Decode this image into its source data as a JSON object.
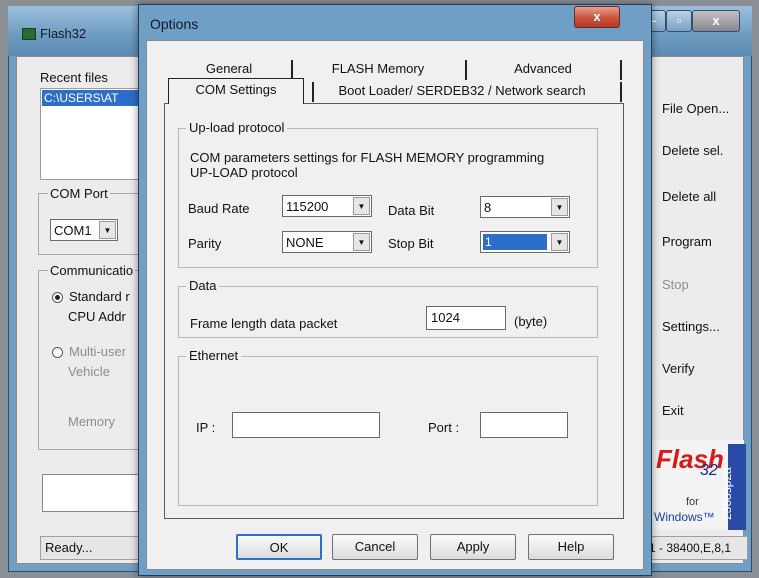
{
  "bg_window": {
    "title": "Flash32",
    "recent_label": "Recent files",
    "recent_selected": "C:\\USERS\\AT",
    "com_port_label": "COM Port",
    "com_port_value": "COM1",
    "communication_label": "Communicatio",
    "standard_label": "Standard r",
    "cpu_addr_label": "CPU Addr",
    "multi_user_label": "Multi-user",
    "vehicle_label": "Vehicle",
    "memory_label": "Memory",
    "status": "Ready...",
    "serial_status": "1 - 38400,E,8,1",
    "buttons": {
      "file_open": "File Open...",
      "delete_sel": "Delete sel.",
      "delete_all": "Delete all",
      "program": "Program",
      "stop": "Stop",
      "settings": "Settings...",
      "verify": "Verify",
      "exit": "Exit"
    },
    "logo": {
      "flash": "Flash",
      "num": "32",
      "for": "for",
      "windows": "Windows™",
      "version": "2368sp2a"
    }
  },
  "dialog": {
    "title": "Options",
    "close_glyph": "x",
    "tabs_row1": [
      "General",
      "FLASH Memory",
      "Advanced"
    ],
    "tabs_row2": [
      "COM Settings",
      "Boot Loader/ SERDEB32 / Network search"
    ],
    "upload": {
      "legend": "Up-load protocol",
      "desc1": "COM parameters settings for FLASH MEMORY programming",
      "desc2": "UP-LOAD protocol",
      "baud_label": "Baud Rate",
      "baud_value": "115200",
      "databit_label": "Data Bit",
      "databit_value": "8",
      "parity_label": "Parity",
      "parity_value": "NONE",
      "stopbit_label": "Stop Bit",
      "stopbit_value": "1"
    },
    "data": {
      "legend": "Data",
      "frame_label": "Frame length data packet",
      "frame_value": "1024",
      "frame_unit": "(byte)"
    },
    "ethernet": {
      "legend": "Ethernet",
      "ip_label": "IP :",
      "ip_value": "",
      "port_label": "Port :",
      "port_value": ""
    },
    "buttons": {
      "ok": "OK",
      "cancel": "Cancel",
      "apply": "Apply",
      "help": "Help"
    }
  }
}
